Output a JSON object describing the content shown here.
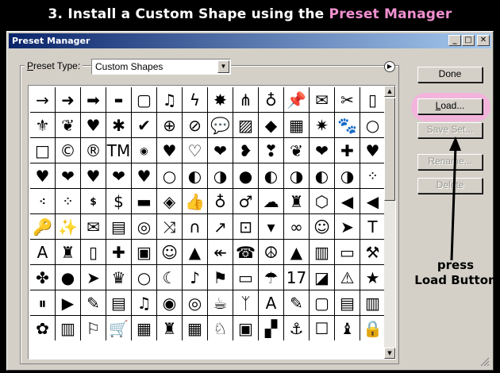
{
  "headline": {
    "prefix": "3. Install a Custom Shape using the ",
    "highlight": "Preset Manager"
  },
  "window": {
    "title": "Preset Manager",
    "minimize": "_",
    "maximize": "□",
    "close": "✕"
  },
  "preset_type": {
    "label_prefix": "",
    "label_underlined": "P",
    "label_rest": "reset Type:",
    "value": "Custom Shapes"
  },
  "buttons": {
    "done": "Done",
    "load": "Load...",
    "save_set": "Save Set...",
    "rename": "Rename...",
    "delete": "Delete"
  },
  "annotation": {
    "line1": "press",
    "line2": "Load Button",
    "highlight_color": "#f4b2dd"
  },
  "shapes": [
    "→",
    "➜",
    "➡",
    "▬",
    "▢",
    "♫",
    "ϟ",
    "✸",
    "⋔",
    "♁",
    "📌",
    "✉",
    "✂",
    "▯",
    "⚜",
    "❦",
    "♥",
    "✱",
    "✔",
    "⊕",
    "⊘",
    "💬",
    "▨",
    "◆",
    "▦",
    "✷",
    "🐾",
    "○",
    "□",
    "©",
    "®",
    "TM",
    "◉",
    "♥",
    "♡",
    "❤",
    "❥",
    "❣",
    "❦",
    "❤",
    "✚",
    "♥",
    "♥",
    "❤",
    "♥",
    "❤",
    "♥",
    "○",
    "◐",
    "◑",
    "●",
    "◐",
    "◑",
    "◐",
    "◑",
    "⁘",
    "⁖",
    "⁘",
    "$",
    "$",
    "▬",
    "◈",
    "👍",
    "♁",
    "♂",
    "☁",
    "♜",
    "⬡",
    "◀",
    "◀",
    "🔑",
    "✨",
    "✉",
    "▤",
    "◎",
    "⤨",
    "∩",
    "↗",
    "⊡",
    "▾",
    "∞",
    "☺",
    "➤",
    "T",
    "A",
    "♜",
    "▯",
    "✚",
    "▣",
    "☺",
    "▲",
    "↞",
    "☎",
    "☮",
    "▲",
    "▥",
    "▭",
    "⚒",
    "✤",
    "●",
    "➤",
    "♛",
    "○",
    "☾",
    "♪",
    "⚑",
    "▭",
    "☂",
    "17",
    "◪",
    "⚠",
    "★",
    "⏸",
    "▶",
    "✎",
    "▤",
    "♫",
    "◉",
    "◎",
    "☕",
    "ᛉ",
    "A",
    "✎",
    "▢",
    "▤",
    "▥",
    "✿",
    "▥",
    "⚐",
    "🛒",
    "▦",
    "♜",
    "▦",
    "♘",
    "▣",
    "▞",
    "⚓",
    "☐",
    "♝",
    "🔒"
  ],
  "small_shapes": [
    3,
    32,
    55,
    56,
    57,
    58
  ]
}
